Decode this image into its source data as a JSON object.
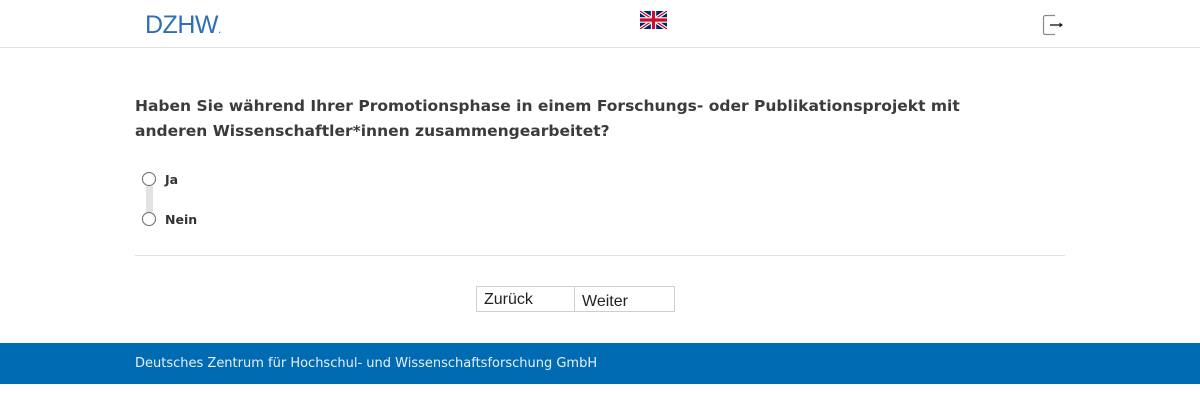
{
  "header": {
    "logo_text": "DZHW",
    "logo_dot": ".",
    "language_flag_icon": "uk-flag-icon",
    "logout_icon": "logout-icon"
  },
  "survey": {
    "question": "Haben Sie während Ihrer Promotionsphase in einem Forschungs- oder Publikationsprojekt mit anderen Wissenschaftler*innen zusammengearbeitet?",
    "options": [
      {
        "label": "Ja",
        "selected": false
      },
      {
        "label": "Nein",
        "selected": false
      }
    ]
  },
  "navigation": {
    "back_label": "Zurück",
    "next_label": "Weiter"
  },
  "footer": {
    "text": "Deutsches Zentrum für Hochschul- und Wissenschaftsforschung GmbH"
  },
  "colors": {
    "brand": "#2f6fb6",
    "footer_bg": "#006ab3"
  }
}
